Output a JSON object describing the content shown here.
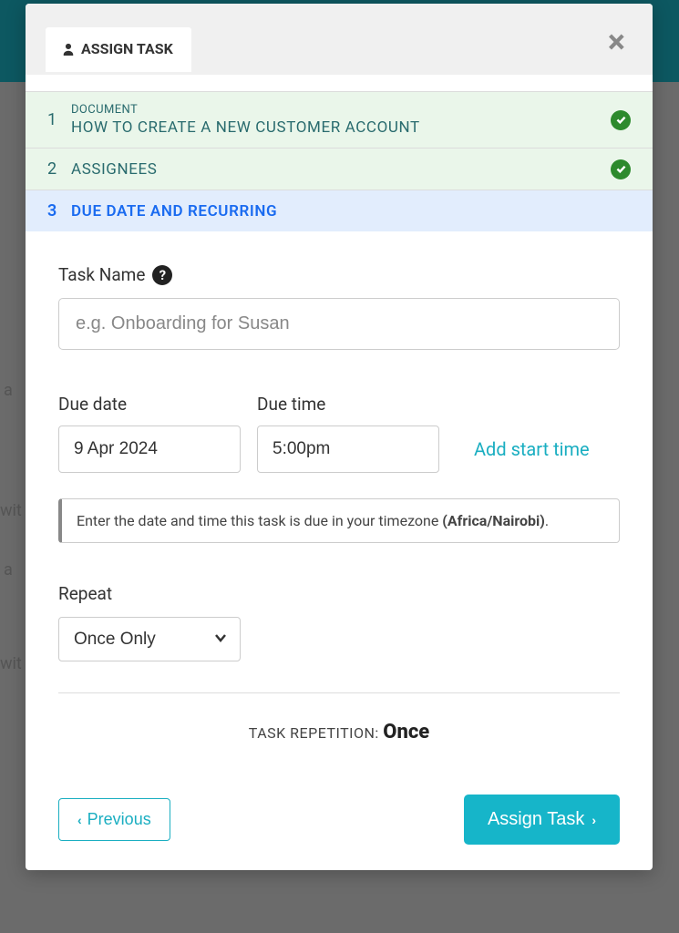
{
  "header": {
    "tab_label": "ASSIGN TASK"
  },
  "steps": [
    {
      "num": "1",
      "sub": "DOCUMENT",
      "title": "HOW TO CREATE A NEW CUSTOMER ACCOUNT"
    },
    {
      "num": "2",
      "title": "ASSIGNEES"
    },
    {
      "num": "3",
      "title": "DUE DATE AND RECURRING"
    }
  ],
  "form": {
    "task_name_label": "Task Name",
    "task_name_placeholder": "e.g. Onboarding for Susan",
    "due_date_label": "Due date",
    "due_date_value": "9 Apr 2024",
    "due_time_label": "Due time",
    "due_time_value": "5:00pm",
    "add_start_time": "Add start time",
    "hint_prefix": "Enter the date and time this task is due in your timezone ",
    "hint_tz": "(Africa/Nairobi)",
    "hint_suffix": ".",
    "repeat_label": "Repeat",
    "repeat_value": "Once Only",
    "repetition_label": "TASK REPETITION: ",
    "repetition_value": "Once"
  },
  "footer": {
    "previous": "Previous",
    "assign": "Assign Task"
  }
}
